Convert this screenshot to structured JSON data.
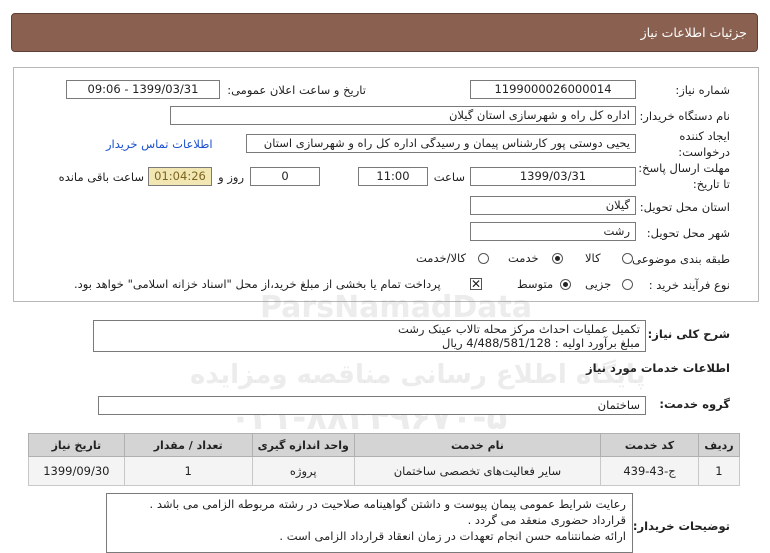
{
  "header": {
    "title": "جزئیات اطلاعات نیاز"
  },
  "form": {
    "need_number_label": "شماره نیاز:",
    "need_number": "1199000026000014",
    "announce_label": "تاریخ و ساعت اعلان عمومی:",
    "announce_value": "1399/03/31 - 09:06",
    "buyer_org_label": "نام دستگاه خریدار:",
    "buyer_org": "اداره کل راه و شهرسازی استان گیلان",
    "creator_label_1": "ایجاد کننده",
    "creator_label_2": "درخواست:",
    "creator": "یحیی دوستی پور کارشناس پیمان و رسیدگی اداره کل راه و شهرسازی استان",
    "contact_link": "اطلاعات تماس خریدار",
    "deadline_label_1": "مهلت ارسال پاسخ:",
    "deadline_label_2": "تا تاریخ:",
    "deadline_date": "1399/03/31",
    "time_label": "ساعت",
    "deadline_time": "11:00",
    "days_value": "0",
    "days_label": "روز و",
    "remaining_time": "01:04:26",
    "remaining_label": "ساعت باقی مانده",
    "province_label": "استان محل تحویل:",
    "province": "گیلان",
    "city_label": "شهر محل تحویل:",
    "city": "رشت",
    "category_label": "طبقه بندی موضوعی:",
    "category_options": [
      "کالا",
      "خدمت",
      "کالا/خدمت"
    ],
    "category_selected": "خدمت",
    "process_label": "نوع فرآیند خرید :",
    "process_options": [
      "جزیی",
      "متوسط"
    ],
    "process_selected": "متوسط",
    "payment_note": "پرداخت تمام یا بخشی از مبلغ خرید،از محل \"اسناد خزانه اسلامی\" خواهد بود."
  },
  "summary": {
    "label": "شرح کلی نیاز:",
    "line1": "تکمیل عملیات احداث مرکز محله تالاب عینک رشت",
    "line2": "مبلغ برآورد اولیه : 4/488/581/128 ریال"
  },
  "services": {
    "section_title": "اطلاعات خدمات مورد نیاز",
    "group_label": "گروه خدمت:",
    "group_value": "ساختمان",
    "columns": [
      "ردیف",
      "کد خدمت",
      "نام خدمت",
      "واحد اندازه گیری",
      "تعداد / مقدار",
      "تاریخ نیاز"
    ],
    "rows": [
      {
        "row": "1",
        "code": "ج-43-439",
        "name": "سایر فعالیت‌های تخصصی ساختمان",
        "unit": "پروژه",
        "qty": "1",
        "date": "1399/09/30"
      }
    ]
  },
  "buyer_notes": {
    "label": "توضیحات خریدار:",
    "lines": [
      "رعایت شرایط عمومی پیمان پیوست و داشتن گواهینامه صلاحیت در رشته مربوطه الزامی می باشد .",
      "قرارداد حضوری منعقد می گردد .",
      "ارائه ضمانتنامه حسن انجام تعهدات در زمان انعقاد قرارداد الزامی است ."
    ]
  },
  "watermark": {
    "line1": "ParsNamadData",
    "line2": "پایگاه اطلاع رسانی مناقصه ومزایده",
    "line3": "۰۲۱-۸۸۳۴۹۶۷۰-۵"
  }
}
